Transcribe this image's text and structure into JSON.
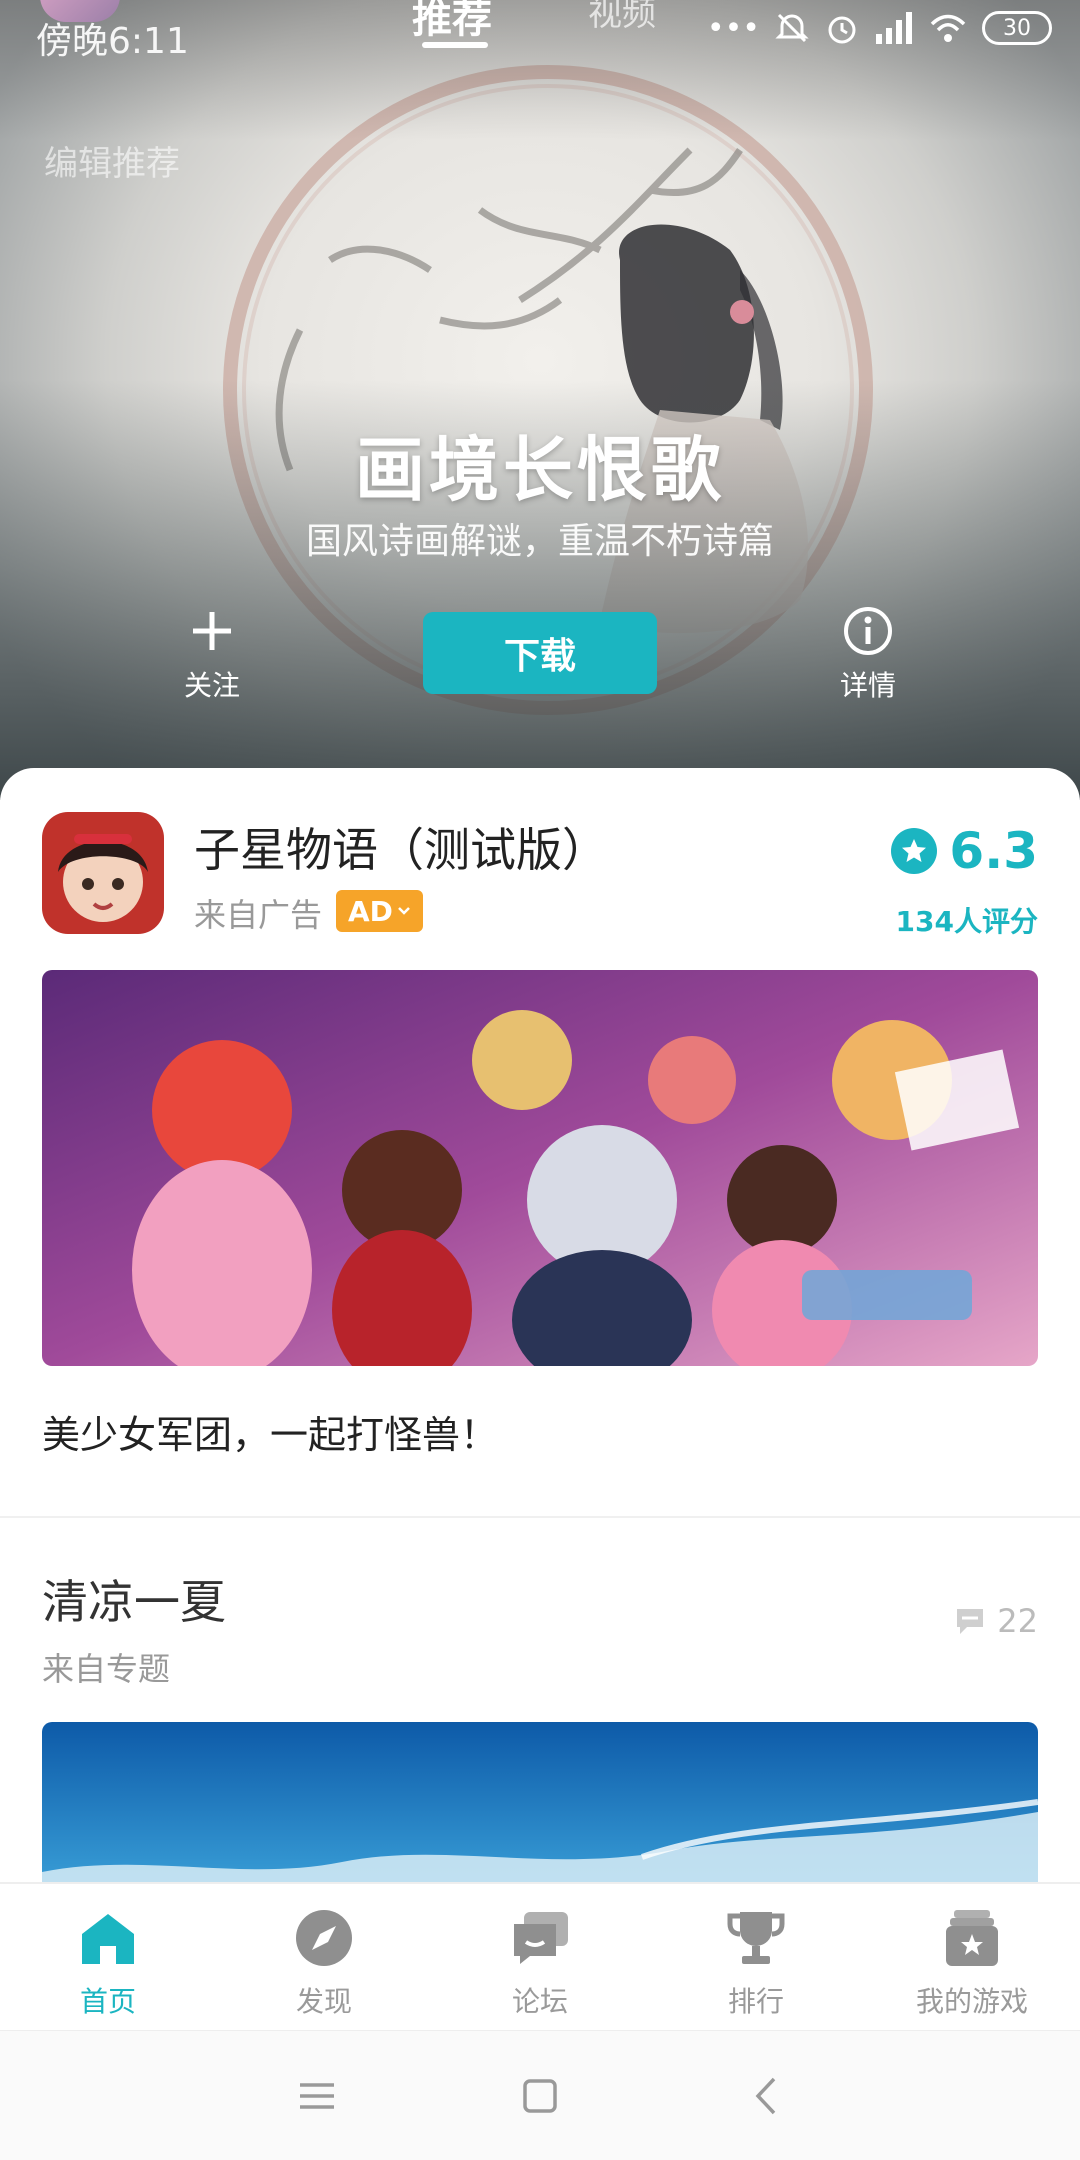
{
  "status_bar": {
    "time": "傍晚6:11",
    "battery": "30"
  },
  "top_tabs": [
    {
      "label": "推荐",
      "active": true
    },
    {
      "label": "视频",
      "active": false
    }
  ],
  "hero": {
    "editor_label": "编辑推荐",
    "title": "画境长恨歌",
    "subtitle": "国风诗画解谜，重温不朽诗篇",
    "follow_label": "关注",
    "download_label": "下载",
    "detail_label": "详情"
  },
  "ad_card": {
    "app_name": "子星物语（测试版）",
    "source": "来自广告",
    "badge": "AD",
    "rating": "6.3",
    "rating_count": "134人评分",
    "caption": "美少女军团，一起打怪兽！"
  },
  "topic_card": {
    "title": "清凉一夏",
    "source": "来自专题",
    "comment_count": "22"
  },
  "bottom_nav": [
    {
      "label": "首页",
      "icon": "home-icon",
      "active": true
    },
    {
      "label": "发现",
      "icon": "compass-icon",
      "active": false
    },
    {
      "label": "论坛",
      "icon": "forum-icon",
      "active": false
    },
    {
      "label": "排行",
      "icon": "trophy-icon",
      "active": false
    },
    {
      "label": "我的游戏",
      "icon": "my-games-icon",
      "active": false
    }
  ],
  "colors": {
    "accent": "#1bb5c1",
    "ad_badge": "#f6a429"
  }
}
